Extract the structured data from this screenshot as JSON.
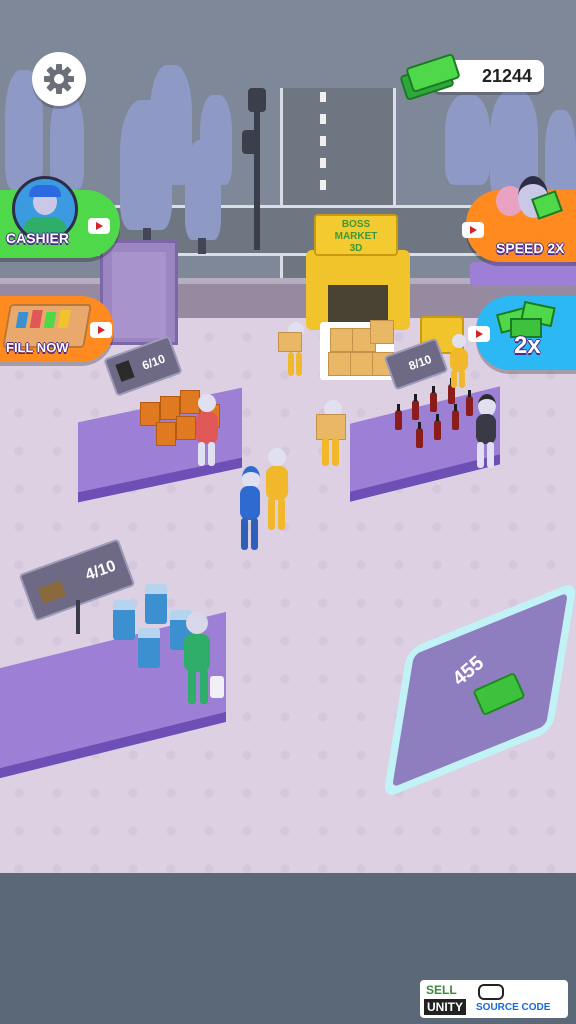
{
  "hud": {
    "money": "21244",
    "settings_icon": "gear-icon",
    "money_icon": "cash-stack-icon"
  },
  "buttons": {
    "cashier": {
      "label": "CASHIER",
      "ad_icon": "video-ad-icon"
    },
    "fill_now": {
      "label": "FILL NOW",
      "ad_icon": "video-ad-icon"
    },
    "speed": {
      "label": "SPEED 2X",
      "ad_icon": "video-ad-icon"
    },
    "money_boost": {
      "label": "2x",
      "ad_icon": "video-ad-icon"
    }
  },
  "truck": {
    "sign_line1": "BOSS",
    "sign_line2": "MARKET",
    "sign_line3": "3D"
  },
  "shelves": [
    {
      "id": "chips",
      "count_label": "6/10",
      "icon": "chips-bag-icon"
    },
    {
      "id": "soda",
      "count_label": "8/10",
      "icon": "soda-bottle-icon"
    },
    {
      "id": "water",
      "count_label": "4/10",
      "icon": "box-icon"
    }
  ],
  "purchase_zone": {
    "price": "455",
    "icon": "cash-icon"
  },
  "watermark": {
    "line1": "SELL",
    "line2": "UNITY",
    "line3": "SOURCE CODE"
  },
  "colors": {
    "floor": "#ddd0e3",
    "shelf": "#9d7fd6",
    "button_green": "#4fd94a",
    "button_orange": "#ff8a1f",
    "button_blue": "#2bb8f5",
    "accent_purple": "#6a3bd6"
  }
}
